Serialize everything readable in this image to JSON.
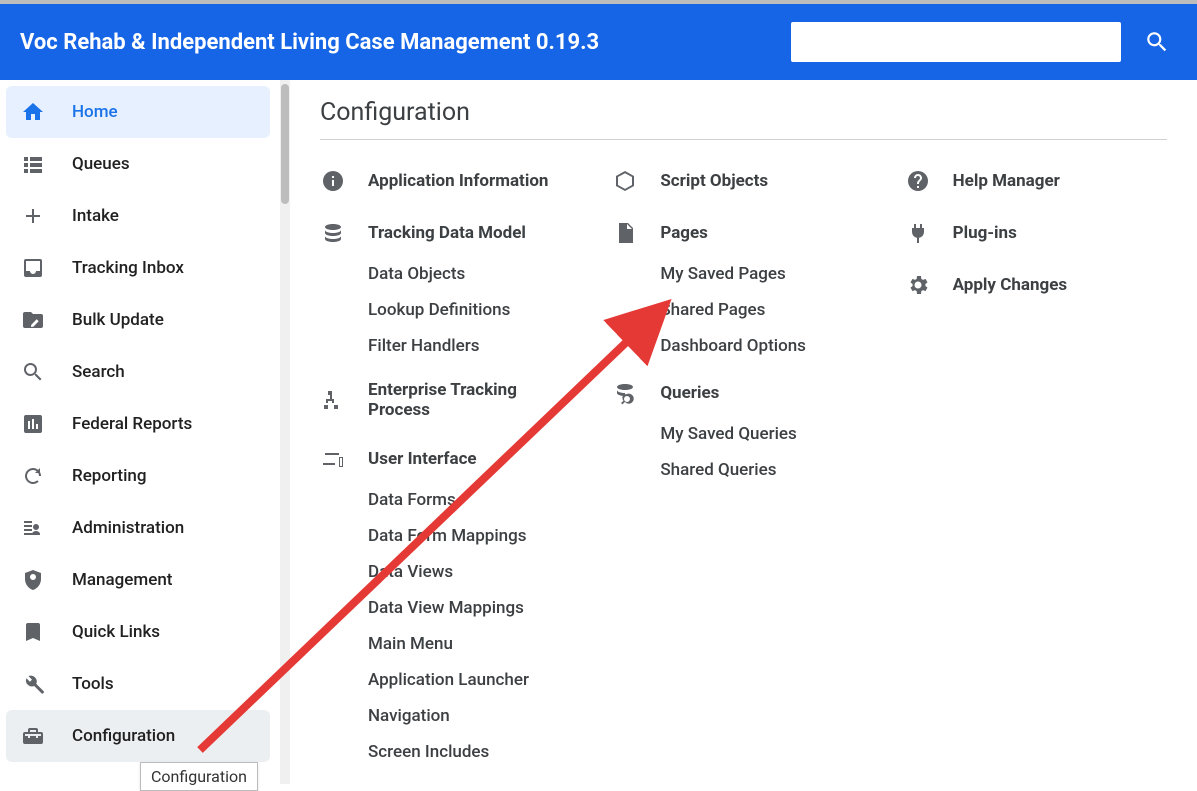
{
  "header": {
    "title": "Voc Rehab & Independent Living Case Management 0.19.3",
    "search_placeholder": ""
  },
  "sidebar": {
    "items": [
      {
        "label": "Home",
        "icon": "home",
        "active": true
      },
      {
        "label": "Queues",
        "icon": "list"
      },
      {
        "label": "Intake",
        "icon": "plus"
      },
      {
        "label": "Tracking Inbox",
        "icon": "inbox"
      },
      {
        "label": "Bulk Update",
        "icon": "folder-edit"
      },
      {
        "label": "Search",
        "icon": "search"
      },
      {
        "label": "Federal Reports",
        "icon": "bar-chart"
      },
      {
        "label": "Reporting",
        "icon": "refresh"
      },
      {
        "label": "Administration",
        "icon": "admin"
      },
      {
        "label": "Management",
        "icon": "shield-person"
      },
      {
        "label": "Quick Links",
        "icon": "bookmark"
      },
      {
        "label": "Tools",
        "icon": "wrench"
      },
      {
        "label": "Configuration",
        "icon": "toolbox",
        "hover": true
      }
    ]
  },
  "tooltip": {
    "text": "Configuration"
  },
  "main": {
    "title": "Configuration",
    "columns": [
      [
        {
          "icon": "info",
          "label": "Application Information",
          "subs": []
        },
        {
          "icon": "database",
          "label": "Tracking Data Model",
          "subs": [
            "Data Objects",
            "Lookup Definitions",
            "Filter Handlers"
          ]
        },
        {
          "icon": "branch",
          "label": "Enterprise Tracking Process",
          "subs": []
        },
        {
          "icon": "devices",
          "label": "User Interface",
          "subs": [
            "Data Forms",
            "Data Form Mappings",
            "Data Views",
            "Data View Mappings",
            "Main Menu",
            "Application Launcher",
            "Navigation",
            "Screen Includes"
          ]
        }
      ],
      [
        {
          "icon": "cube",
          "label": "Script Objects",
          "subs": []
        },
        {
          "icon": "page",
          "label": "Pages",
          "subs": [
            "My Saved Pages",
            "Shared Pages",
            "Dashboard Options"
          ]
        },
        {
          "icon": "db-search",
          "label": "Queries",
          "subs": [
            "My Saved Queries",
            "Shared Queries"
          ]
        }
      ],
      [
        {
          "icon": "help",
          "label": "Help Manager",
          "subs": []
        },
        {
          "icon": "plug",
          "label": "Plug-ins",
          "subs": []
        },
        {
          "icon": "gear",
          "label": "Apply Changes",
          "subs": []
        }
      ]
    ]
  },
  "annotation": {
    "arrow_color": "#e53935"
  }
}
